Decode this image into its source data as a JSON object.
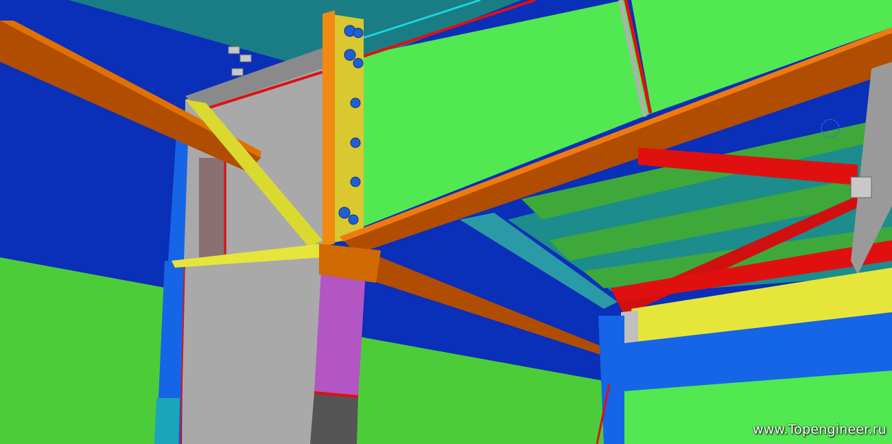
{
  "scene": {
    "description_icon": "steel-frame-3d-model",
    "colors": {
      "wall_blue": "#0a2fb8",
      "panel_green": "#52e852",
      "column_gray": "#a9a9a9",
      "beam_orange": "#b14d00",
      "plate_yellow": "#d9d930",
      "brace_red": "#e01010",
      "purlin_teal": "#1f8a8a",
      "stub_magenta": "#b455c4",
      "bolt_blue": "#1e5fd6"
    }
  },
  "watermark": {
    "text": "www.Topengineer.ru"
  }
}
